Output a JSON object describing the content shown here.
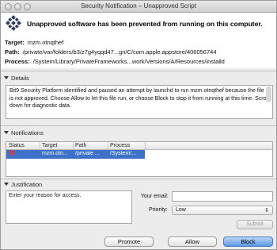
{
  "window": {
    "title": "Security Notification – Unapproved Script"
  },
  "header": {
    "headline": "Unapproved software has been prevented from running on this computer.",
    "target_label": "Target:",
    "target_value": "mzm.otnqthef",
    "path_label": "Path:",
    "path_value": "/private/var/folders/b3/z7g4yqqd47...gn/C/com.apple.appstore/406056744",
    "process_label": "Process:",
    "process_value": "/System/Library/PrivateFrameworks...work/Versions/A/Resources/installd"
  },
  "details": {
    "title": "Details",
    "text": "Bit9 Security Platform identified and paused an attempt by launchd to run mzm.otnqthef because the file is not approved.  Choose Allow to let this file run, or choose Block to stop it from running at this time. Scroll down for diagnostic data."
  },
  "notifications": {
    "title": "Notifications",
    "columns": [
      "Status",
      "Target",
      "Path",
      "Process"
    ],
    "rows": [
      {
        "status_icon": "x-icon",
        "target": "mzm.otn...",
        "path": "/private ...",
        "process": "/System/..."
      }
    ]
  },
  "justification": {
    "title": "Justification",
    "reason_placeholder": "Enter your reason for access.",
    "email_label": "Your email:",
    "priority_label": "Priority:",
    "priority_value": "Low",
    "submit_label": "Submit"
  },
  "buttons": {
    "promote": "Promote",
    "allow": "Allow",
    "block": "Block"
  },
  "colors": {
    "selection": "#3d72c8",
    "primary_button": "#5e98e3",
    "status_error": "#e33333"
  }
}
